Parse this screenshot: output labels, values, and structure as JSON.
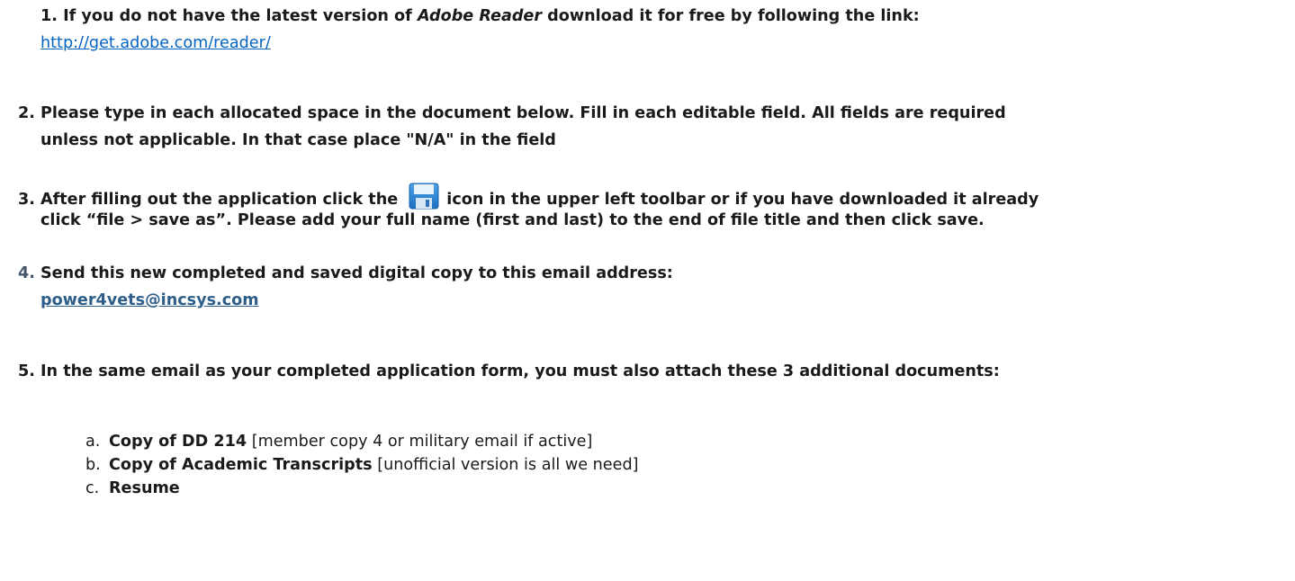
{
  "step1": {
    "number": "1.",
    "text_before": "If you do not have the latest version of",
    "app_name": "Adobe Reader",
    "text_after": "download it for free by following the link:",
    "link": "http://get.adobe.com/reader/"
  },
  "step2": {
    "number": "2.",
    "line1": "Please type in each allocated space in the document below. Fill in each editable field. All fields are required",
    "line2": "unless not applicable. In that case place \"N/A\" in the field"
  },
  "step3": {
    "number": "3.",
    "text_before": "After filling out the application click the",
    "text_after": "icon in the upper left toolbar or if you have downloaded it already",
    "line2": "click “file > save as”. Please add your full name (first and last) to the end of file title and then click save.",
    "icon": "save-icon"
  },
  "step4": {
    "number": "4.",
    "text": "Send this new completed and saved digital copy to this email address:",
    "email": "power4vets@incsys.com"
  },
  "step5": {
    "number": "5.",
    "text": "In the same email as your completed application form, you must also attach these 3 additional documents:",
    "items": [
      {
        "letter": "a.",
        "bold": "Copy of DD 214",
        "note": "[member copy 4 or military email if active]"
      },
      {
        "letter": "b.",
        "bold": "Copy of Academic Transcripts",
        "note": "[unofficial version is all we need]"
      },
      {
        "letter": "c.",
        "bold": "Resume",
        "note": ""
      }
    ]
  },
  "colors": {
    "link": "#0563c1",
    "email_link": "#2e5f8a",
    "step4_number": "#44546a",
    "text": "#1a1a1a"
  }
}
